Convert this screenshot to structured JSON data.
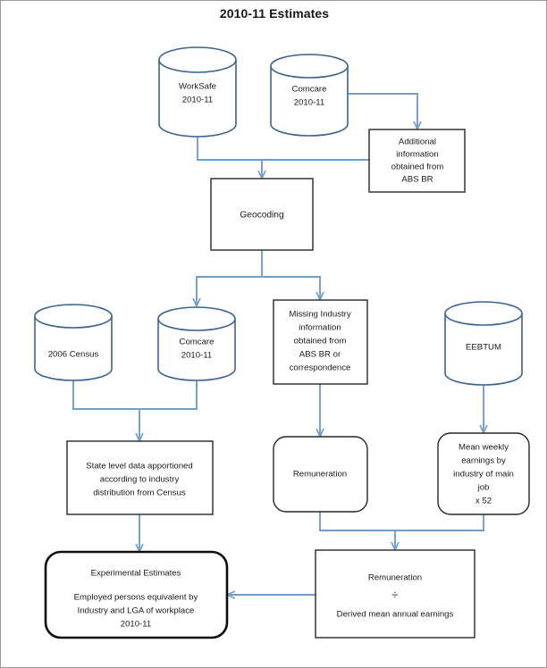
{
  "page": {
    "title": "2010-11 Estimates",
    "border_color": "#9a9a9a",
    "background": "#ffffff"
  },
  "colors": {
    "cylinder_stroke": "#3b6394",
    "box_stroke": "#262626",
    "emphasis_box_stroke": "#0d0d0d",
    "connector": "#6f9fd0",
    "text": "#1a1a1a"
  },
  "nodes": {
    "worksafe": {
      "type": "cylinder",
      "lines": [
        "WorkSafe",
        "2010-11"
      ]
    },
    "comcare_top": {
      "type": "cylinder",
      "lines": [
        "Comcare",
        "2010-11"
      ]
    },
    "additional_info": {
      "type": "rectangle",
      "lines": [
        "Additional",
        "information",
        "obtained from",
        "ABS BR"
      ]
    },
    "geocoding": {
      "type": "rectangle",
      "lines": [
        "Geocoding"
      ]
    },
    "census_2006": {
      "type": "cylinder",
      "lines": [
        "2006 Census"
      ]
    },
    "comcare_mid": {
      "type": "cylinder",
      "lines": [
        "Comcare",
        "2010-11"
      ]
    },
    "missing_industry": {
      "type": "rectangle",
      "lines": [
        "Missing Industry",
        "information",
        "obtained from",
        "ABS BR or",
        "correspondence"
      ]
    },
    "eebtum": {
      "type": "cylinder",
      "lines": [
        "EEBTUM"
      ]
    },
    "state_level_data": {
      "type": "rectangle",
      "lines": [
        "State level data apportioned",
        "according to industry",
        "distribution from Census"
      ]
    },
    "remuneration": {
      "type": "rounded-rectangle",
      "lines": [
        "Remuneration"
      ]
    },
    "mean_weekly_earnings": {
      "type": "rounded-rectangle",
      "lines": [
        "Mean weekly",
        "earnings by",
        "industry of main",
        "job",
        "x 52"
      ]
    },
    "experimental_estimates": {
      "type": "rounded-rectangle-thick",
      "lines": [
        "Experimental Estimates",
        "",
        "Employed persons equivalent by",
        "Industry and LGA of workplace",
        "2010-11"
      ]
    },
    "remuneration_divided": {
      "type": "rectangle",
      "lines": [
        "Remuneration",
        "÷",
        "Derived mean annual earnings"
      ]
    }
  },
  "edges": [
    {
      "from": "worksafe",
      "to": "geocoding"
    },
    {
      "from": "comcare_top",
      "to": "additional_info"
    },
    {
      "from": "additional_info",
      "to": "geocoding"
    },
    {
      "from": "geocoding",
      "to": "comcare_mid"
    },
    {
      "from": "geocoding",
      "to": "missing_industry"
    },
    {
      "from": "census_2006",
      "to": "state_level_data"
    },
    {
      "from": "comcare_mid",
      "to": "state_level_data"
    },
    {
      "from": "missing_industry",
      "to": "remuneration"
    },
    {
      "from": "eebtum",
      "to": "mean_weekly_earnings"
    },
    {
      "from": "state_level_data",
      "to": "experimental_estimates"
    },
    {
      "from": "remuneration",
      "to": "remuneration_divided"
    },
    {
      "from": "mean_weekly_earnings",
      "to": "remuneration_divided"
    },
    {
      "from": "remuneration_divided",
      "to": "experimental_estimates"
    }
  ]
}
